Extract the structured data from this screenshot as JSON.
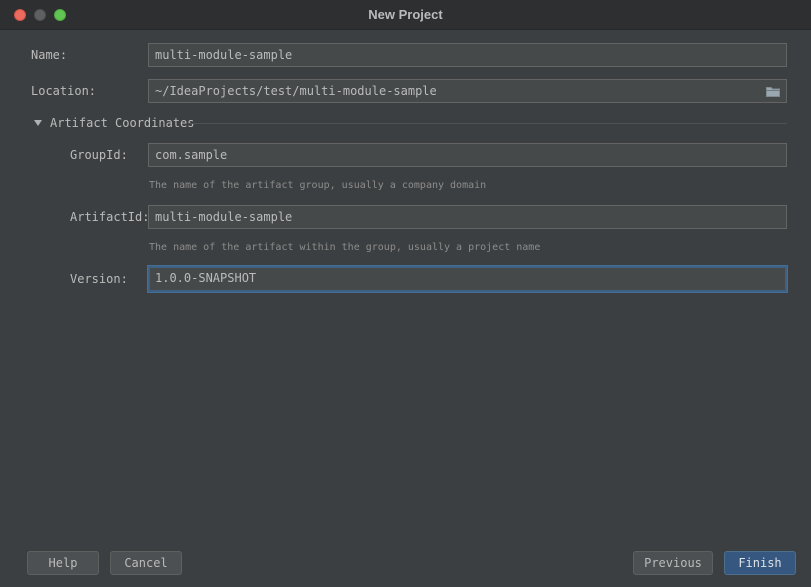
{
  "window": {
    "title": "New Project"
  },
  "form": {
    "name": {
      "label": "Name:",
      "value": "multi-module-sample"
    },
    "location": {
      "label": "Location:",
      "value": "~/IdeaProjects/test/multi-module-sample",
      "icon": "folder-icon"
    },
    "artifact_section": {
      "label": "Artifact Coordinates",
      "expanded": true
    },
    "group_id": {
      "label": "GroupId:",
      "value": "com.sample",
      "hint": "The name of the artifact group, usually a company domain"
    },
    "artifact_id": {
      "label": "ArtifactId:",
      "value": "multi-module-sample",
      "hint": "The name of the artifact within the group, usually a project name"
    },
    "version": {
      "label": "Version:",
      "value": "1.0.0-SNAPSHOT"
    }
  },
  "buttons": {
    "help": "Help",
    "cancel": "Cancel",
    "previous": "Previous",
    "finish": "Finish"
  },
  "colors": {
    "background": "#3c3f41",
    "field": "#45494a",
    "focus": "#3d6185",
    "primary_button": "#365880"
  }
}
